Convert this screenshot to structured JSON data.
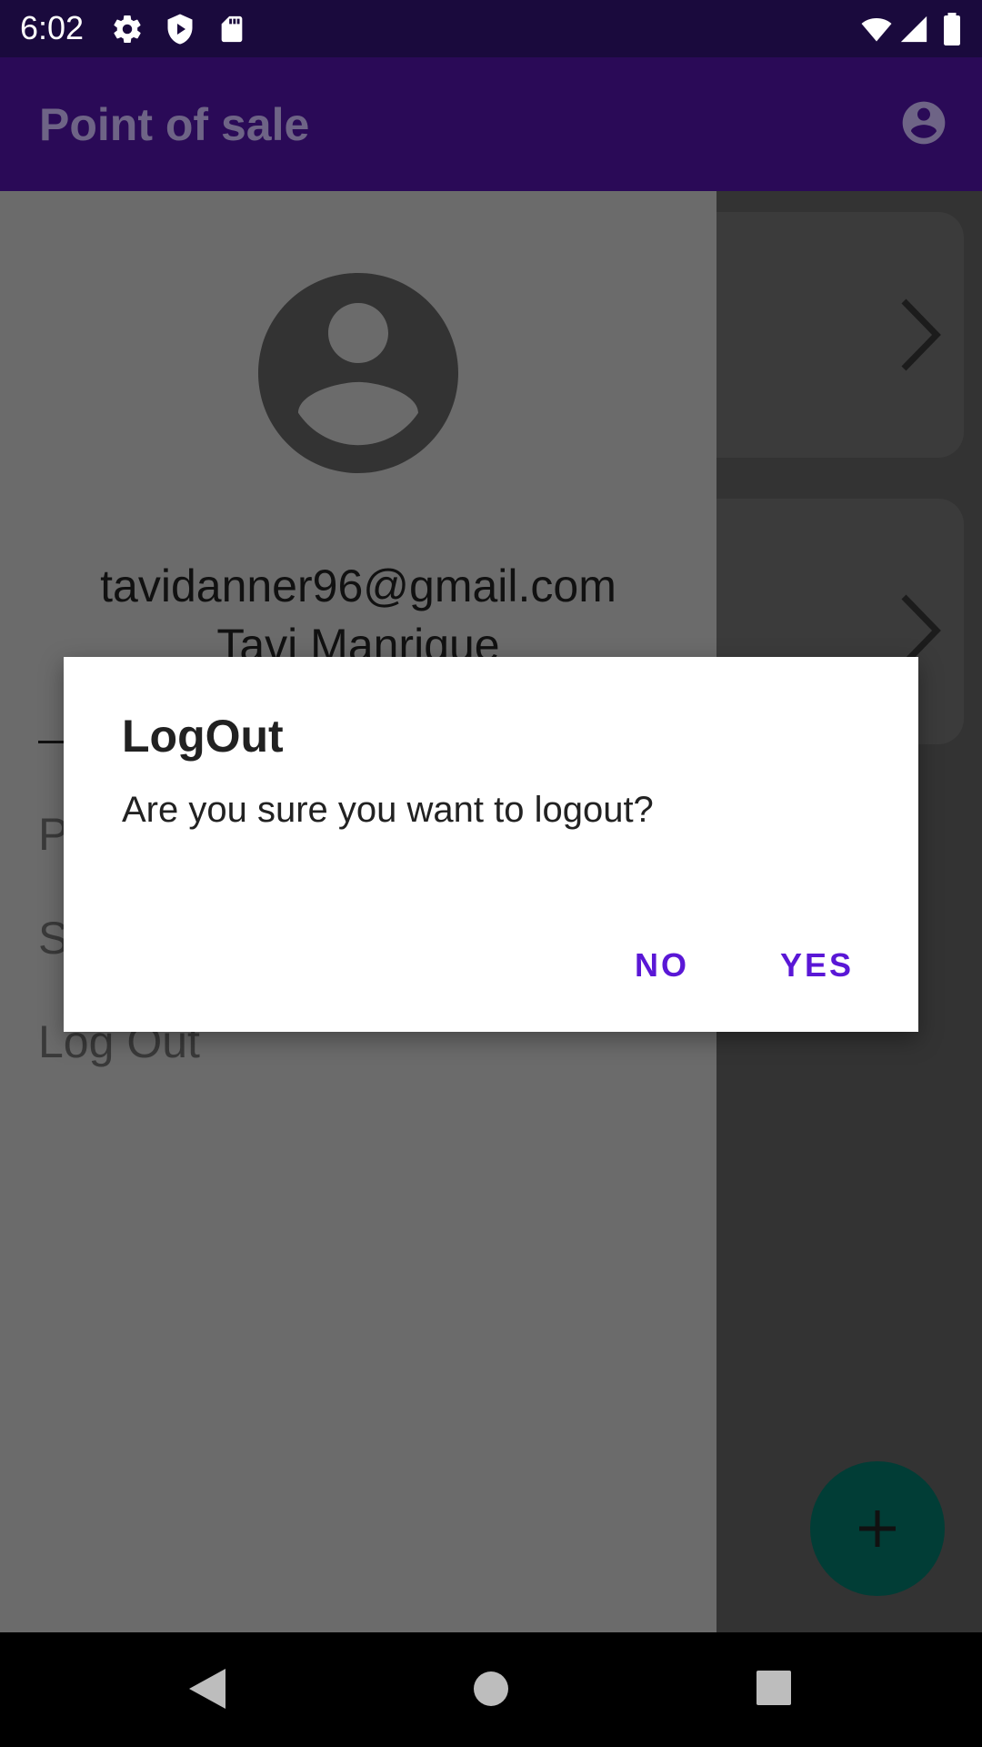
{
  "status_bar": {
    "time": "6:02",
    "icons": [
      "settings-icon",
      "shield-icon",
      "sd-card-icon",
      "wifi-icon",
      "signal-icon",
      "battery-icon"
    ]
  },
  "app_bar": {
    "title": "Point of sale",
    "account_icon": "account-circle-icon"
  },
  "drawer": {
    "email": "tavidanner96@gmail.com",
    "name": "Tavi Manrique",
    "items": [
      "P",
      "S",
      "Log Out"
    ]
  },
  "dialog": {
    "title": "LogOut",
    "message": "Are you sure you want to logout?",
    "no_label": "NO",
    "yes_label": "YES"
  },
  "fab": {
    "icon": "plus-icon"
  },
  "nav_bar": {
    "back_icon": "back-icon",
    "home_icon": "home-icon",
    "recents_icon": "recents-icon"
  },
  "colors": {
    "status_bar": "#1a0a3d",
    "app_bar": "#2a0a57",
    "accent": "#5a17d6",
    "fab": "#013d36"
  }
}
